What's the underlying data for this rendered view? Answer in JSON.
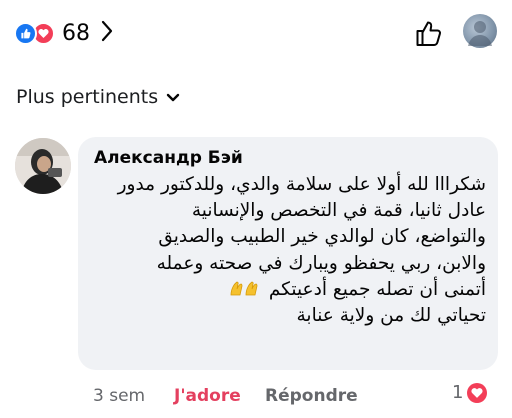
{
  "reactions": {
    "count": "68",
    "types": [
      "like-icon",
      "love-icon"
    ]
  },
  "sort": {
    "label": "Plus pertinents"
  },
  "comment": {
    "author": "Александр Бэй",
    "lines": [
      "شكرااا لله أولا على سلامة والدي، وللدكتور مدور",
      "عادل ثانيا، قمة في التخصص والإنسانية",
      "والتواضع، كان لوالدي خير الطبيب والصديق",
      "والابن، ربي يحفظو ويبارك في صحته وعمله",
      "أتمنى أن تصله جميع أدعيتكم",
      "تحياتي لك من ولاية عنابة"
    ],
    "time": "3 sem",
    "reaction_label": "J'adore",
    "reply_label": "Répondre",
    "reaction_count": "1"
  },
  "colors": {
    "accent": "#1877f2",
    "love": "#f33e58",
    "jadore": "#e4405f",
    "bubble": "#f0f2f5"
  }
}
